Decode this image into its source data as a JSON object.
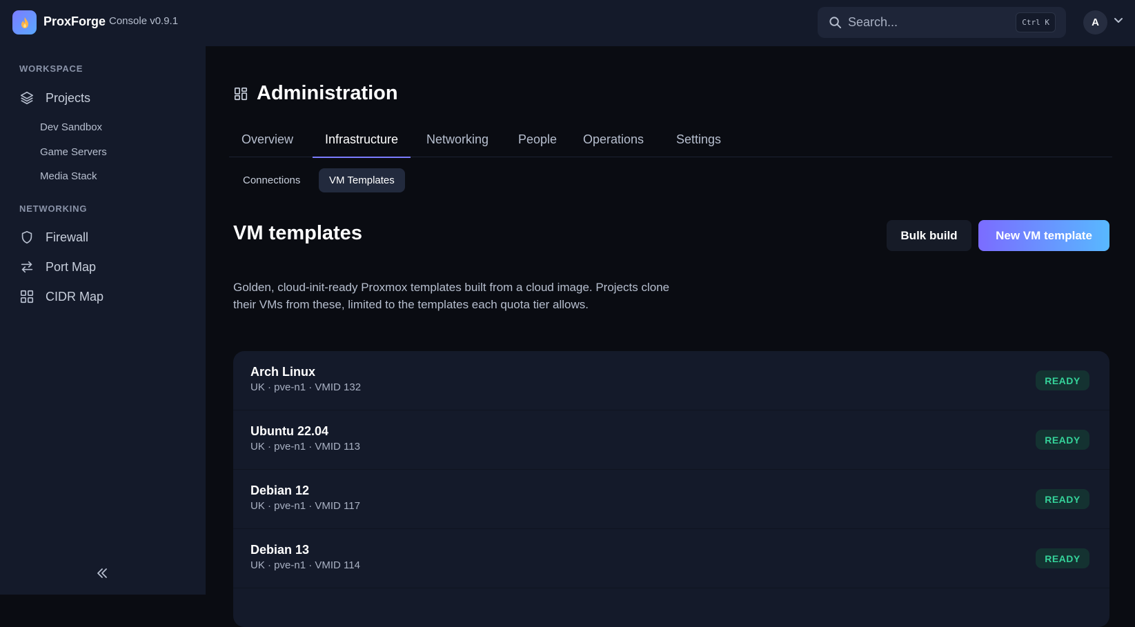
{
  "app": {
    "brand": "ProxForge",
    "version": "Console v0.9.1"
  },
  "search": {
    "placeholder": "Search...",
    "shortcut": "Ctrl K"
  },
  "user": {
    "avatar_initial": "A"
  },
  "sidebar": {
    "workspace_label": "WORKSPACE",
    "projects_label": "Projects",
    "projects": [
      "Dev Sandbox",
      "Game Servers",
      "Media Stack"
    ],
    "networking_label": "NETWORKING",
    "networking_items": [
      "Firewall",
      "Port Map",
      "CIDR Map"
    ]
  },
  "page": {
    "title": "Administration",
    "tabs": [
      "Overview",
      "Infrastructure",
      "Networking",
      "People",
      "Operations",
      "Settings"
    ],
    "active_tab": "Infrastructure",
    "subtabs": [
      "Connections",
      "VM Templates"
    ],
    "active_subtab": "VM Templates"
  },
  "section": {
    "title": "VM templates",
    "bulk_build_label": "Bulk build",
    "new_template_label": "New VM template",
    "description": "Golden, cloud-init-ready Proxmox templates built from a cloud image. Projects clone their VMs from these, limited to the templates each quota tier allows."
  },
  "templates": [
    {
      "name": "Arch Linux",
      "meta": "UK · pve-n1 · VMID 132",
      "status": "READY"
    },
    {
      "name": "Ubuntu 22.04",
      "meta": "UK · pve-n1 · VMID 113",
      "status": "READY"
    },
    {
      "name": "Debian 12",
      "meta": "UK · pve-n1 · VMID 117",
      "status": "READY"
    },
    {
      "name": "Debian 13",
      "meta": "UK · pve-n1 · VMID 114",
      "status": "READY"
    }
  ],
  "colors": {
    "accent": "#7b7cff",
    "status_ready": "#35d39a"
  }
}
